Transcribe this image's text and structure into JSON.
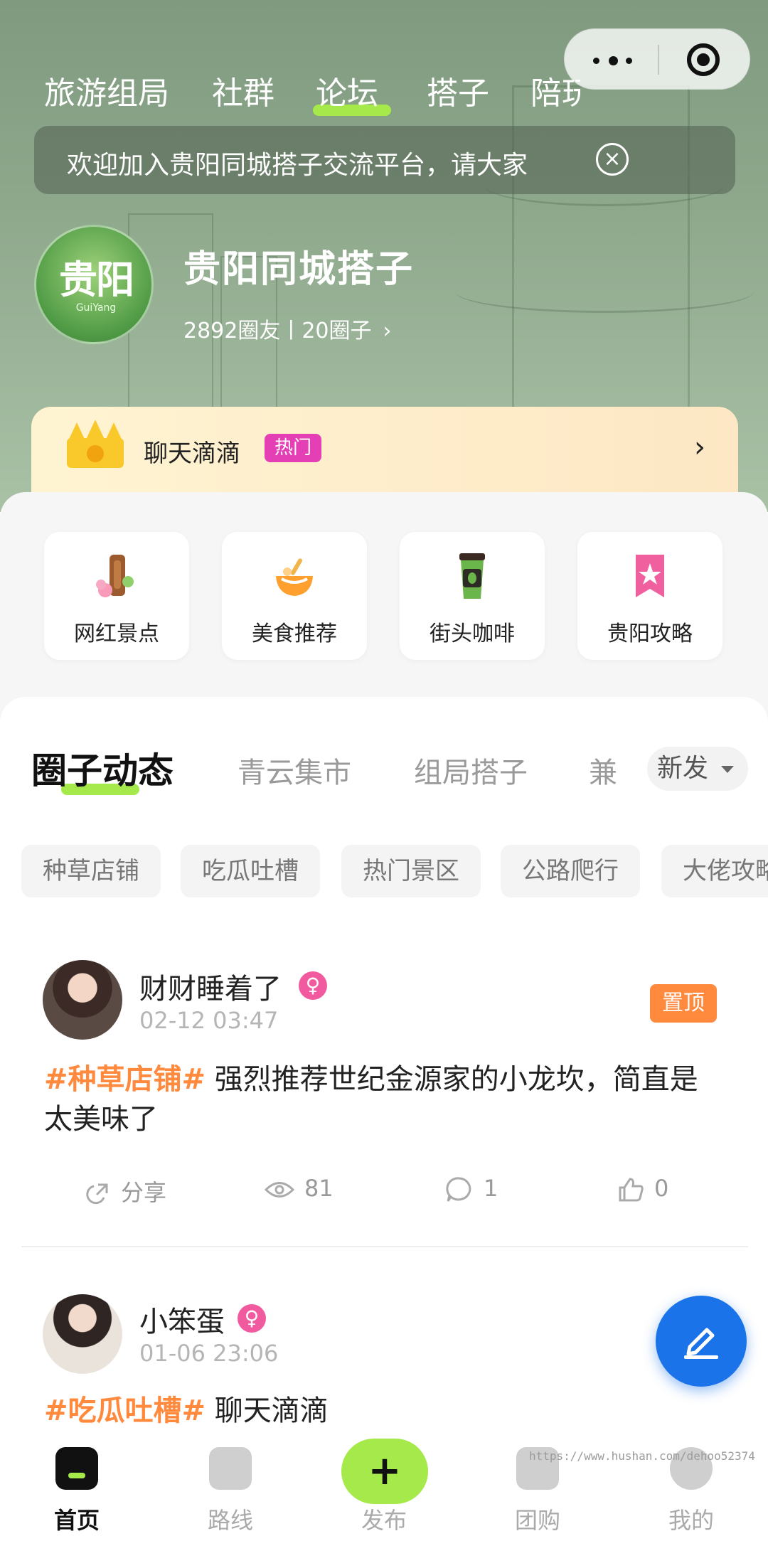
{
  "capsule": {
    "more_icon": "more-dots-icon",
    "close_icon": "target-circle-icon"
  },
  "top_tabs": [
    "旅游组局",
    "社群",
    "论坛",
    "搭子",
    "陪玩"
  ],
  "top_tab_active": "论坛",
  "notice": {
    "text": "欢迎加入贵阳同城搭子交流平台，请大家",
    "close_icon": "close-circle-icon"
  },
  "group": {
    "logo_text": "贵阳",
    "logo_sub": "GuiYang",
    "title": "贵阳同城搭子",
    "stats": "2892圈友丨20圈子",
    "chevron": "›"
  },
  "chat_card": {
    "name": "聊天滴滴",
    "badge": "热门",
    "arrow": "›",
    "icon": "crown-icon"
  },
  "quick_links": [
    {
      "label": "网红景点",
      "icon": "tree-flower-icon"
    },
    {
      "label": "美食推荐",
      "icon": "food-bowl-icon"
    },
    {
      "label": "街头咖啡",
      "icon": "coffee-cup-icon"
    },
    {
      "label": "贵阳攻略",
      "icon": "bookmark-star-icon"
    }
  ],
  "section_tabs": [
    "圈子动态",
    "青云集市",
    "组局搭子",
    "兼"
  ],
  "section_active": "圈子动态",
  "new_button": "新发",
  "chips": [
    "种草店铺",
    "吃瓜吐槽",
    "热门景区",
    "公路爬行",
    "大佬攻略"
  ],
  "posts": [
    {
      "author": "财财睡着了",
      "gender": "♀",
      "time": "02-12 03:47",
      "pinned": "置顶",
      "tag": "#种草店铺#",
      "text": " 强烈推荐世纪金源家的小龙坎，简直是太美味了",
      "share": "分享",
      "views": "81",
      "comments": "1",
      "likes": "0"
    },
    {
      "author": "小笨蛋",
      "gender": "♀",
      "time": "01-06 23:06",
      "tag": "#吃瓜吐槽#",
      "text": " 聊天滴滴"
    }
  ],
  "fab_icon": "edit-pen-icon",
  "bottom_nav": [
    {
      "label": "首页",
      "icon": "home-icon"
    },
    {
      "label": "路线",
      "icon": "route-icon"
    },
    {
      "label": "发布",
      "icon": "plus-icon"
    },
    {
      "label": "团购",
      "icon": "group-buy-icon"
    },
    {
      "label": "我的",
      "icon": "profile-icon"
    }
  ],
  "nav_active": "首页",
  "watermark": "https://www.hushan.com/dehoo52374",
  "colors": {
    "accent": "#a6e94b",
    "tag": "#ff8a3d",
    "hot": "#e43fb5",
    "fab": "#1a73e8"
  }
}
